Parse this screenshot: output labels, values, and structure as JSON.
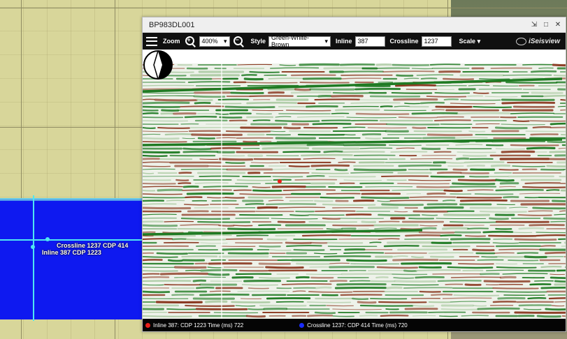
{
  "window": {
    "title": "BP983DL001"
  },
  "toolbar": {
    "zoom_label": "Zoom",
    "zoom_value": "400%",
    "style_label": "Style",
    "style_value": "Green-White-Brown",
    "inline_label": "Inline",
    "inline_value": "387",
    "crossline_label": "Crossline",
    "crossline_value": "1237",
    "scale_label": "Scale",
    "brand": "iSeisview"
  },
  "map": {
    "label_crossline": "Crossline 1237 CDP 414",
    "label_inline": "Inline 387 CDP 1223"
  },
  "status": {
    "inline_text": "Inline 387: CDP 1223 Time (ms) 722",
    "crossline_text": "Crossline 1237: CDP 414 Time (ms) 720",
    "inline_color": "#e8201a",
    "crossline_color": "#1a2cff"
  },
  "colors": {
    "water": "#0e19f0",
    "cursor": "#4fe7f0",
    "seismic_green": "#1e7a22",
    "seismic_brown": "#8b3a22"
  }
}
